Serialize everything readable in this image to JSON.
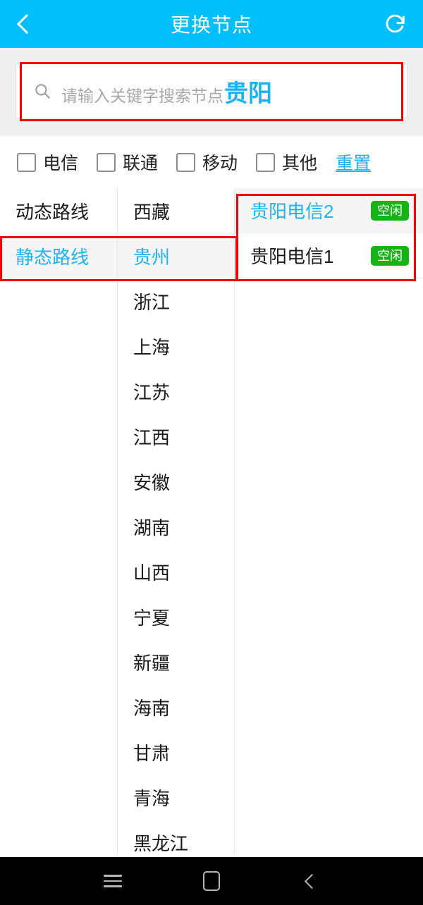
{
  "header": {
    "title": "更换节点",
    "back_icon": "chevron-left-icon",
    "refresh_icon": "refresh-icon"
  },
  "search": {
    "icon": "search-icon",
    "placeholder": "请输入关键字搜索节点",
    "value": "贵阳"
  },
  "filters": {
    "checkboxes": [
      {
        "label": "电信",
        "checked": false
      },
      {
        "label": "联通",
        "checked": false
      },
      {
        "label": "移动",
        "checked": false
      },
      {
        "label": "其他",
        "checked": false
      }
    ],
    "reset_label": "重置"
  },
  "columns": {
    "routes": [
      {
        "label": "动态路线",
        "selected": false
      },
      {
        "label": "静态路线",
        "selected": true
      }
    ],
    "provinces": [
      {
        "label": "西藏",
        "selected": false
      },
      {
        "label": "贵州",
        "selected": true
      },
      {
        "label": "浙江",
        "selected": false
      },
      {
        "label": "上海",
        "selected": false
      },
      {
        "label": "江苏",
        "selected": false
      },
      {
        "label": "江西",
        "selected": false
      },
      {
        "label": "安徽",
        "selected": false
      },
      {
        "label": "湖南",
        "selected": false
      },
      {
        "label": "山西",
        "selected": false
      },
      {
        "label": "宁夏",
        "selected": false
      },
      {
        "label": "新疆",
        "selected": false
      },
      {
        "label": "海南",
        "selected": false
      },
      {
        "label": "甘肃",
        "selected": false
      },
      {
        "label": "青海",
        "selected": false
      },
      {
        "label": "黑龙江",
        "selected": false
      }
    ],
    "nodes": [
      {
        "name": "贵阳电信2",
        "status": "空闲",
        "selected": true
      },
      {
        "name": "贵阳电信1",
        "status": "空闲",
        "selected": false
      }
    ]
  },
  "navbar": {
    "recents_icon": "hamburger-icon",
    "home_icon": "home-square-icon",
    "back_icon": "chevron-left-icon"
  },
  "colors": {
    "accent": "#00BFFA",
    "link": "#1EB2F5",
    "badge_green": "#15B315",
    "annotation_red": "#f70000"
  }
}
